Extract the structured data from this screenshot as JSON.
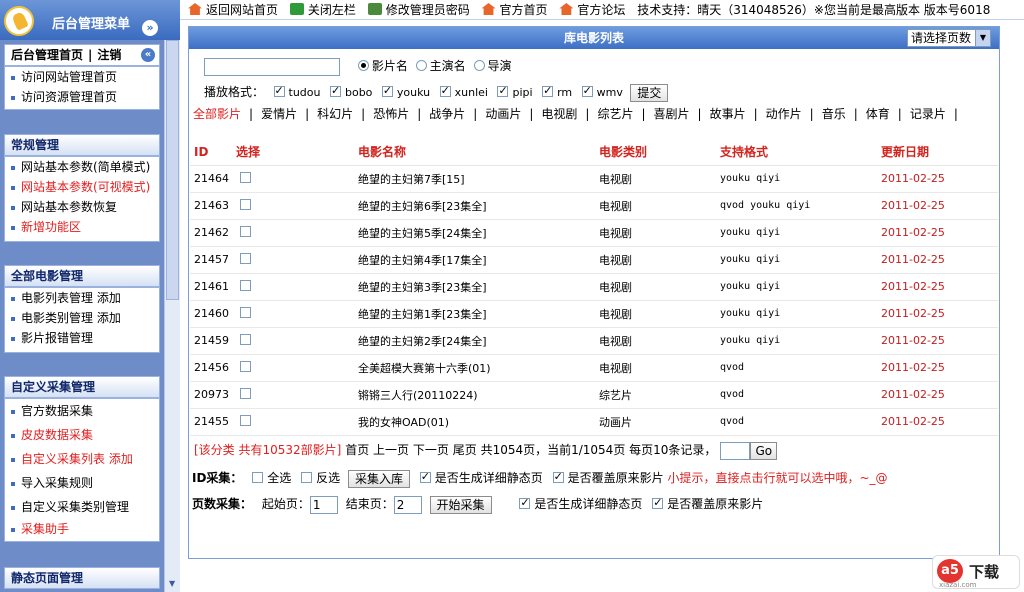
{
  "sidebar": {
    "title": "后台管理菜单",
    "user_home": "后台管理首页",
    "logout": "注销",
    "top_links": [
      "访问网站管理首页",
      "访问资源管理首页"
    ],
    "sections": [
      {
        "title": "常规管理",
        "items": [
          {
            "label": "网站基本参数(简单模式)",
            "red": false
          },
          {
            "label": "网站基本参数(可视模式)",
            "red": true
          },
          {
            "label": "网站基本参数恢复",
            "red": false
          },
          {
            "label": "新增功能区",
            "red": true
          }
        ]
      },
      {
        "title": "全部电影管理",
        "items": [
          {
            "label": "电影列表管理 添加",
            "red": false
          },
          {
            "label": "电影类别管理 添加",
            "red": false
          },
          {
            "label": "影片报错管理",
            "red": false
          }
        ]
      },
      {
        "title": "自定义采集管理",
        "items": [
          {
            "label": "官方数据采集",
            "red": false
          },
          {
            "label": "皮皮数据采集",
            "red": true
          },
          {
            "label": "自定义采集列表 添加",
            "red": true
          },
          {
            "label": "导入采集规则",
            "red": false
          },
          {
            "label": "自定义采集类别管理",
            "red": false
          },
          {
            "label": "采集助手",
            "red": true
          }
        ]
      },
      {
        "title": "静态页面管理",
        "items": []
      }
    ]
  },
  "topbar": {
    "home": "返回网站首页",
    "close_left": "关闭左栏",
    "change_pwd": "修改管理员密码",
    "official_home": "官方首页",
    "official_forum": "官方论坛",
    "support": "技术支持：晴天（314048526）※您当前是最高版本 版本号6018"
  },
  "main": {
    "title": "库电影列表",
    "page_select": "请选择页数",
    "search": {
      "radios": [
        "影片名",
        "主演名",
        "导演"
      ],
      "selected": 0
    },
    "format_label": "播放格式：",
    "formats": [
      "tudou",
      "bobo",
      "youku",
      "xunlei",
      "pipi",
      "rm",
      "wmv"
    ],
    "submit": "提交",
    "categories": [
      "全部影片",
      "爱情片",
      "科幻片",
      "恐怖片",
      "战争片",
      "动画片",
      "电视剧",
      "综艺片",
      "喜剧片",
      "故事片",
      "动作片",
      "音乐",
      "体育",
      "记录片"
    ],
    "columns": [
      "ID",
      "选择",
      "电影名称",
      "电影类别",
      "支持格式",
      "更新日期"
    ],
    "rows": [
      [
        "21464",
        "绝望的主妇第7季[15]",
        "电视剧",
        "youku qiyi",
        "2011-02-25"
      ],
      [
        "21463",
        "绝望的主妇第6季[23集全]",
        "电视剧",
        "qvod youku qiyi",
        "2011-02-25"
      ],
      [
        "21462",
        "绝望的主妇第5季[24集全]",
        "电视剧",
        "youku qiyi",
        "2011-02-25"
      ],
      [
        "21457",
        "绝望的主妇第4季[17集全]",
        "电视剧",
        "youku qiyi",
        "2011-02-25"
      ],
      [
        "21461",
        "绝望的主妇第3季[23集全]",
        "电视剧",
        "youku qiyi",
        "2011-02-25"
      ],
      [
        "21460",
        "绝望的主妇第1季[23集全]",
        "电视剧",
        "youku qiyi",
        "2011-02-25"
      ],
      [
        "21459",
        "绝望的主妇第2季[24集全]",
        "电视剧",
        "youku qiyi",
        "2011-02-25"
      ],
      [
        "21456",
        "全美超模大赛第十六季(01)",
        "电视剧",
        "qvod",
        "2011-02-25"
      ],
      [
        "20973",
        "锵锵三人行(20110224)",
        "综艺片",
        "qvod",
        "2011-02-25"
      ],
      [
        "21455",
        "我的女神OAD(01)",
        "动画片",
        "qvod",
        "2011-02-25"
      ]
    ],
    "pager": {
      "info": "[该分类 共有10532部影片]",
      "first": "首页",
      "prev": "上一页",
      "next": "下一页",
      "last": "尾页",
      "total": "共1054页，当前1/1054页",
      "per_page": "每页10条记录，",
      "go": "Go"
    },
    "id_collect": {
      "label": "ID采集：",
      "select_all": "全选",
      "invert": "反选",
      "button": "采集入库",
      "gen_static": "是否生成详细静态页",
      "overwrite": "是否覆盖原来影片",
      "tip": "小提示，直接点击行就可以选中哦，~_@"
    },
    "page_collect": {
      "label": "页数采集：",
      "start_label": "起始页：",
      "start_value": "1",
      "end_label": "结束页：",
      "end_value": "2",
      "button": "开始采集",
      "gen_static": "是否生成详细静态页",
      "overwrite": "是否覆盖原来影片"
    }
  },
  "watermark": {
    "logo": "a5",
    "text": "下载",
    "url": "xiazai.com"
  }
}
